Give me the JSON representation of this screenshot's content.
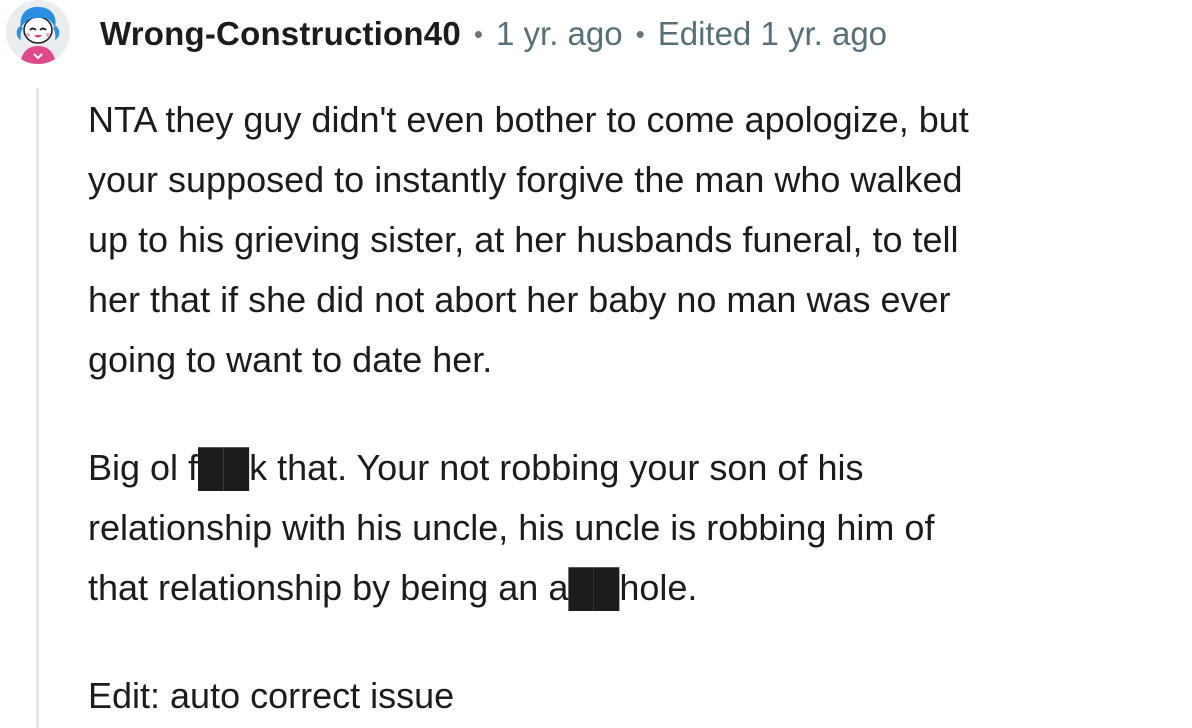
{
  "comment": {
    "username": "Wrong-Construction40",
    "posted_time": "1 yr. ago",
    "edited_label": "Edited 1 yr. ago",
    "separator": "•",
    "paragraphs": [
      "NTA they guy didn't even bother to come apologize, but\nyour supposed to instantly forgive the man who walked\nup to his grieving sister, at her husbands funeral, to tell\nher that if she did not abort her baby no man was ever\ngoing to want to date her.",
      "Big ol f██k that. Your not robbing your son of his\nrelationship with his uncle, his uncle is robbing him of\nthat relationship by being an a██hole.",
      "Edit: auto correct issue"
    ]
  },
  "colors": {
    "text": "#1c1c1c",
    "meta": "#576f76",
    "thread_line": "#e4e7e9",
    "avatar_hair": "#2a8fe0",
    "avatar_shirt": "#e04a8a"
  },
  "icons": {
    "avatar": "snoo-avatar-blue-hair"
  }
}
